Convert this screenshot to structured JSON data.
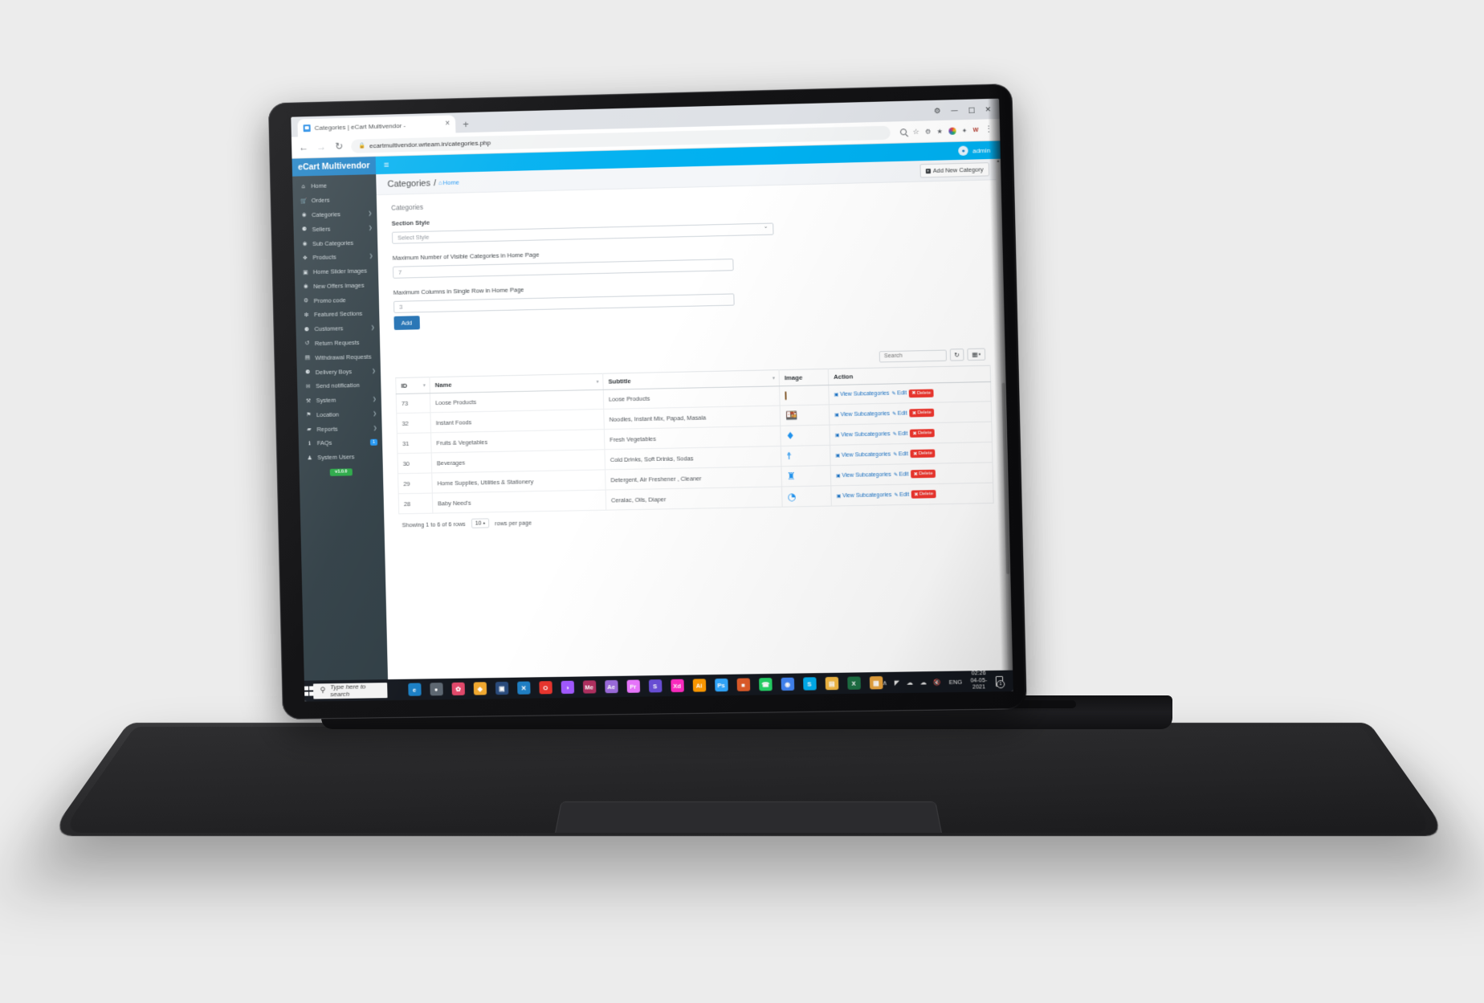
{
  "browser": {
    "tab_title": "Categories | eCart Multivendor -",
    "tab_close": "×",
    "new_tab": "+",
    "back": "←",
    "forward": "→",
    "reload": "↻",
    "lock_icon": "🔒",
    "url": "ecartmultivendor.wrteam.in/categories.php",
    "kebab": "⋮",
    "win_minimize": "—",
    "win_maximize": "□",
    "win_close": "✕",
    "win_settings": "⚙",
    "toolbar_icons": [
      "search-icon",
      "star-icon",
      "extension-icon",
      "shield-icon",
      "profile-icon",
      "puzzle-icon",
      "app-icon"
    ]
  },
  "topbar": {
    "brand": "eCart Multivendor",
    "menu_toggle": "≡",
    "user_label": "admin",
    "user_icon": "👤"
  },
  "sidebar": {
    "version": "v1.0.0",
    "items": [
      {
        "label": "Home",
        "icon": "",
        "glyph": "⌂",
        "caret": false
      },
      {
        "label": "Orders",
        "icon": "cart",
        "glyph": "🛒",
        "caret": false
      },
      {
        "label": "Categories",
        "icon": "circle",
        "glyph": "◉",
        "caret": true
      },
      {
        "label": "Sellers",
        "icon": "person",
        "glyph": "⚈",
        "caret": true
      },
      {
        "label": "Sub Categories",
        "icon": "circle",
        "glyph": "◉",
        "caret": false
      },
      {
        "label": "Products",
        "icon": "box",
        "glyph": "❖",
        "caret": true
      },
      {
        "label": "Home Slider Images",
        "icon": "image",
        "glyph": "▣",
        "caret": false
      },
      {
        "label": "New Offers Images",
        "icon": "camera",
        "glyph": "◉",
        "caret": false
      },
      {
        "label": "Promo code",
        "icon": "tag",
        "glyph": "⚙",
        "caret": false
      },
      {
        "label": "Featured Sections",
        "icon": "star",
        "glyph": "❇",
        "caret": false
      },
      {
        "label": "Customers",
        "icon": "person",
        "glyph": "⚈",
        "caret": true
      },
      {
        "label": "Return Requests",
        "icon": "refresh",
        "glyph": "↺",
        "caret": false
      },
      {
        "label": "Withdrawal Requests",
        "icon": "card",
        "glyph": "▤",
        "caret": false
      },
      {
        "label": "Delivery Boys",
        "icon": "person",
        "glyph": "⚈",
        "caret": true
      },
      {
        "label": "Send notification",
        "icon": "bell",
        "glyph": "✉",
        "caret": false
      },
      {
        "label": "System",
        "icon": "wrench",
        "glyph": "⚒",
        "caret": true
      },
      {
        "label": "Location",
        "icon": "pin",
        "glyph": "⚑",
        "caret": true
      },
      {
        "label": "Reports",
        "icon": "folder",
        "glyph": "▰",
        "caret": true
      },
      {
        "label": "FAQs",
        "icon": "info",
        "glyph": "ℹ",
        "caret": false,
        "badge": "1"
      },
      {
        "label": "System Users",
        "icon": "users",
        "glyph": "♟",
        "caret": false
      }
    ]
  },
  "page": {
    "title": "Categories",
    "separator": "/",
    "breadcrumb_icon": "⌂",
    "breadcrumb": "Home",
    "add_new_label": "Add New Category",
    "add_new_icon": "+"
  },
  "form": {
    "section_label": "Categories",
    "section_style_label": "Section Style",
    "section_style_value": "Select Style",
    "section_style_caret": "⌄",
    "max_visible_label": "Maximum Number of Visible Categories in Home Page",
    "max_visible_value": "7",
    "max_columns_label": "Maximum Columns in Single Row in Home Page",
    "max_columns_value": "3",
    "add_button": "Add"
  },
  "table_tools": {
    "search_placeholder": "Search",
    "refresh_icon": "↻",
    "columns_icon": "▦",
    "columns_caret": "▾"
  },
  "table": {
    "columns": [
      "ID",
      "Name",
      "Subtitle",
      "Image",
      "Action"
    ],
    "sort_indicator": "▾",
    "rows": [
      {
        "id": "73",
        "name": "Loose Products",
        "subtitle": "Loose Products",
        "image_kind": "photo",
        "image_glyph": ""
      },
      {
        "id": "32",
        "name": "Instant Foods",
        "subtitle": "Noodles, Instant Mix, Papad, Masala",
        "image_kind": "icon",
        "image_glyph": "🍱"
      },
      {
        "id": "31",
        "name": "Fruits & Vegetables",
        "subtitle": "Fresh Vegetables",
        "image_kind": "icon",
        "image_glyph": "♦"
      },
      {
        "id": "30",
        "name": "Beverages",
        "subtitle": "Cold Drinks, Soft Drinks, Sodas",
        "image_kind": "icon",
        "image_glyph": "☨"
      },
      {
        "id": "29",
        "name": "Home Supplies, Utilities & Stationery",
        "subtitle": "Detergent, Air Freshener , Cleaner",
        "image_kind": "icon",
        "image_glyph": "♜"
      },
      {
        "id": "28",
        "name": "Baby Need's",
        "subtitle": "Ceralac, Oils, Diaper",
        "image_kind": "icon",
        "image_glyph": "◔"
      }
    ],
    "action_view": "View Subcategories",
    "action_view_icon": "▣",
    "action_edit": "Edit",
    "action_edit_icon": "✎",
    "action_delete": "Delete",
    "action_delete_icon": "✖"
  },
  "footer": {
    "showing": "Showing 1 to 6 of 6 rows",
    "rows_per_page_value": "10",
    "rows_per_page_caret": "▴",
    "rows_per_page_label": "rows per page"
  },
  "taskbar": {
    "search_placeholder": "Type here to search",
    "search_icon": "⚲",
    "apps": [
      {
        "name": "edge",
        "glyph": "e",
        "color": "#1a7fc4"
      },
      {
        "name": "steam",
        "glyph": "●",
        "color": "#5c6670"
      },
      {
        "name": "paint",
        "glyph": "✿",
        "color": "#e0486a"
      },
      {
        "name": "notes",
        "glyph": "◆",
        "color": "#f0a830"
      },
      {
        "name": "camera",
        "glyph": "▣",
        "color": "#2a4b7c"
      },
      {
        "name": "vscode",
        "glyph": "✕",
        "color": "#1f7fc4"
      },
      {
        "name": "opera",
        "glyph": "O",
        "color": "#e8352e"
      },
      {
        "name": "figma",
        "glyph": "◑",
        "color": "#a259ff"
      },
      {
        "name": "mendeley",
        "glyph": "Me",
        "color": "#b03060"
      },
      {
        "name": "after-effects",
        "glyph": "Ae",
        "color": "#9b6bdb"
      },
      {
        "name": "premiere",
        "glyph": "Pr",
        "color": "#ea77ff"
      },
      {
        "name": "skype-blue",
        "glyph": "S",
        "color": "#6a4fd8"
      },
      {
        "name": "xd",
        "glyph": "Xd",
        "color": "#ff2bc2"
      },
      {
        "name": "illustrator",
        "glyph": "Ai",
        "color": "#ff9a00"
      },
      {
        "name": "photoshop",
        "glyph": "Ps",
        "color": "#31a8ff"
      },
      {
        "name": "toolbox",
        "glyph": "■",
        "color": "#e05c2a"
      },
      {
        "name": "whatsapp",
        "glyph": "☎",
        "color": "#25d366"
      },
      {
        "name": "chrome",
        "glyph": "◉",
        "color": "#4285f4"
      },
      {
        "name": "skype",
        "glyph": "S",
        "color": "#00aff0"
      },
      {
        "name": "explorer",
        "glyph": "▤",
        "color": "#f4b942"
      },
      {
        "name": "excel",
        "glyph": "X",
        "color": "#1d7044"
      },
      {
        "name": "store",
        "glyph": "▦",
        "color": "#e8a33d"
      }
    ],
    "tray": {
      "chevron": "∧",
      "network": "◤",
      "onedrive": "☁",
      "cloud": "☁",
      "volume": "🔇",
      "language": "ENG",
      "time": "02:26",
      "date": "04-05-2021"
    }
  }
}
